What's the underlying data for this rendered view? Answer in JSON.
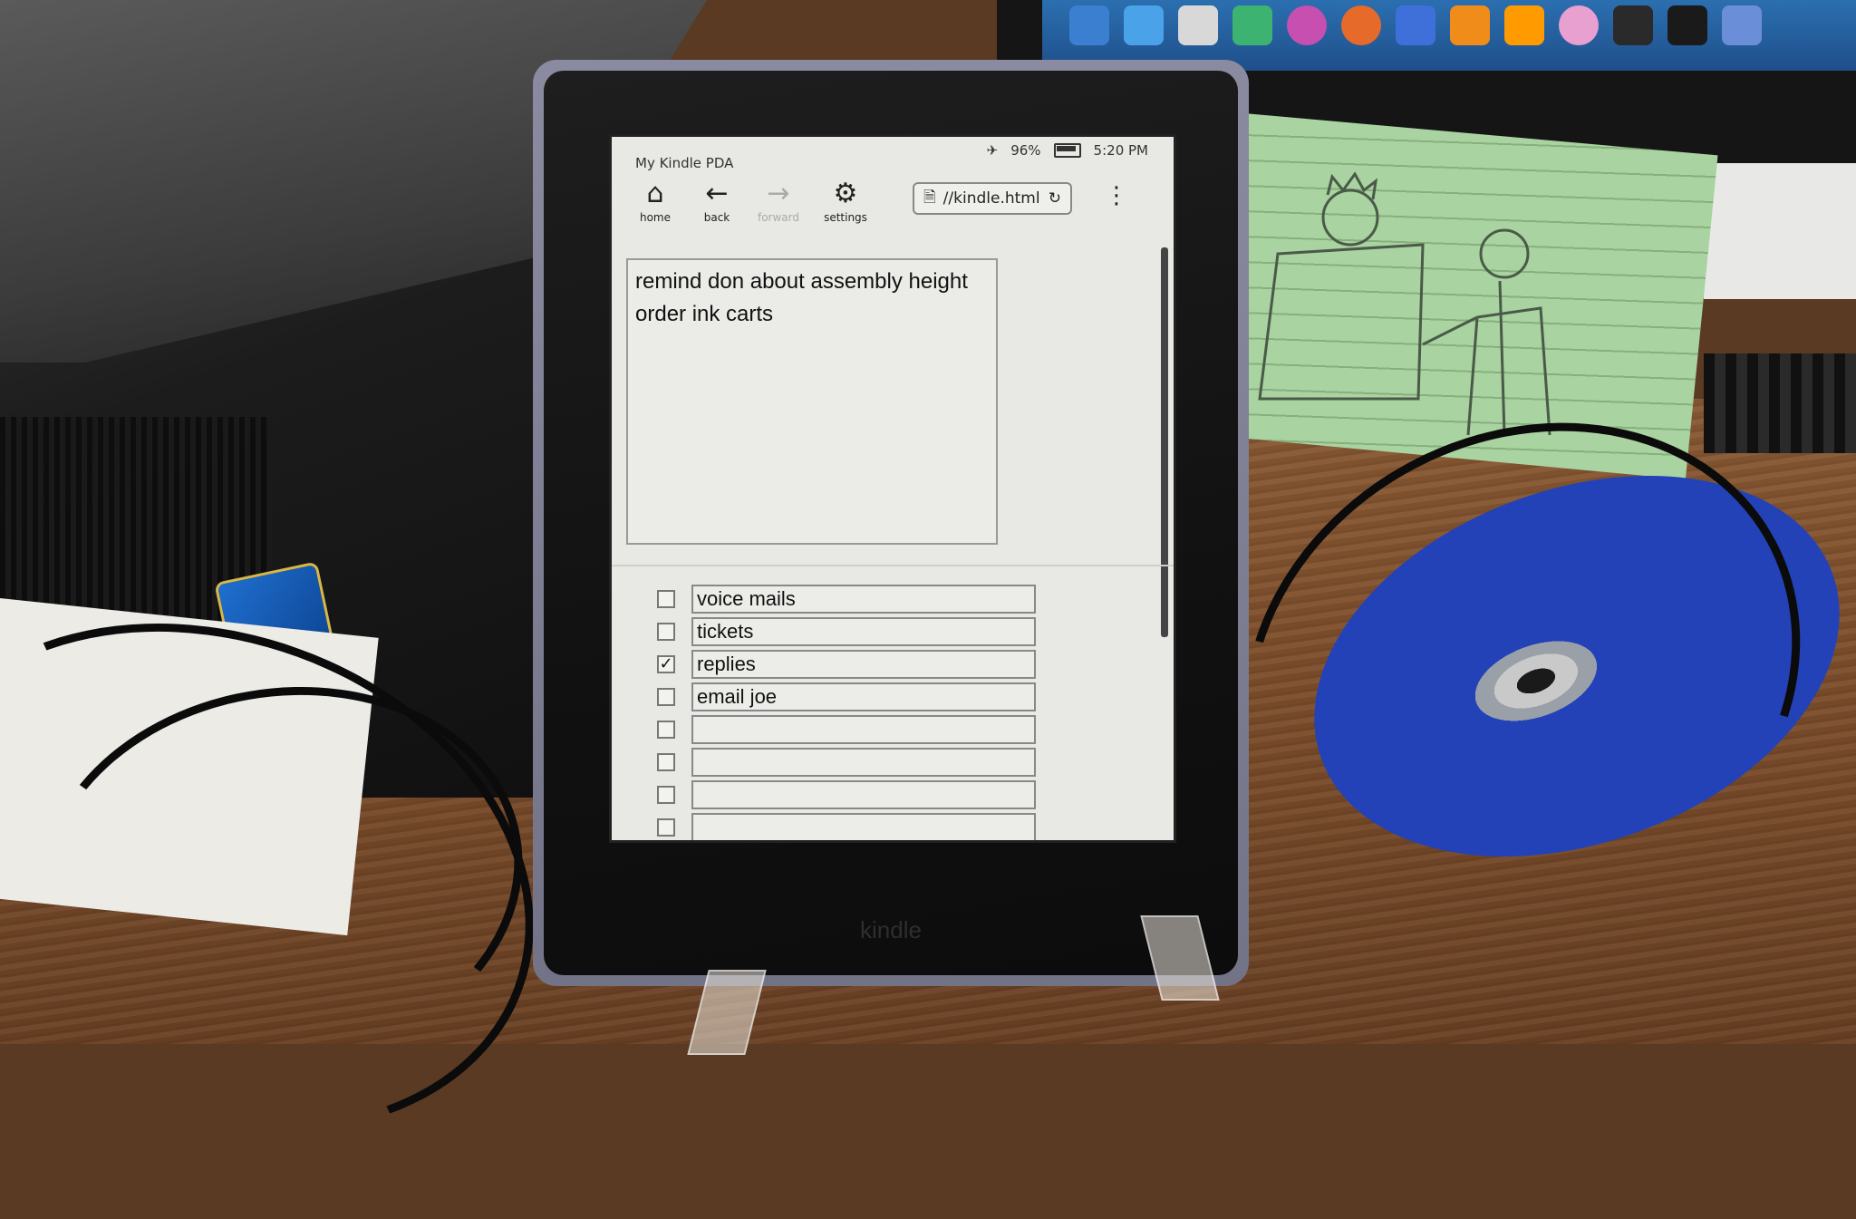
{
  "kindle": {
    "brand_label": "kindle",
    "status": {
      "app_title": "My Kindle PDA",
      "airplane_icon": "airplane-icon",
      "battery": "96%",
      "time": "5:20 PM"
    },
    "toolbar": {
      "home_label": "home",
      "back_label": "back",
      "forward_label": "forward",
      "settings_label": "settings",
      "url": "//kindle.html",
      "page_icon": "document-icon",
      "reload_icon": "reload-icon",
      "menu_icon": "more-vertical-icon"
    },
    "notes": {
      "text": "remind don about assembly height\norder ink carts"
    },
    "checklist": [
      {
        "label": "voice mails",
        "checked": false
      },
      {
        "label": "tickets",
        "checked": false
      },
      {
        "label": "replies",
        "checked": true
      },
      {
        "label": "email joe",
        "checked": false
      },
      {
        "label": "",
        "checked": false
      },
      {
        "label": "",
        "checked": false
      },
      {
        "label": "",
        "checked": false
      },
      {
        "label": "",
        "checked": false
      }
    ]
  },
  "scene_colors": {
    "screen": "#e8e8e4",
    "bezel": "#111111",
    "case": "#7c7c92",
    "desk": "#7a4c2a"
  }
}
